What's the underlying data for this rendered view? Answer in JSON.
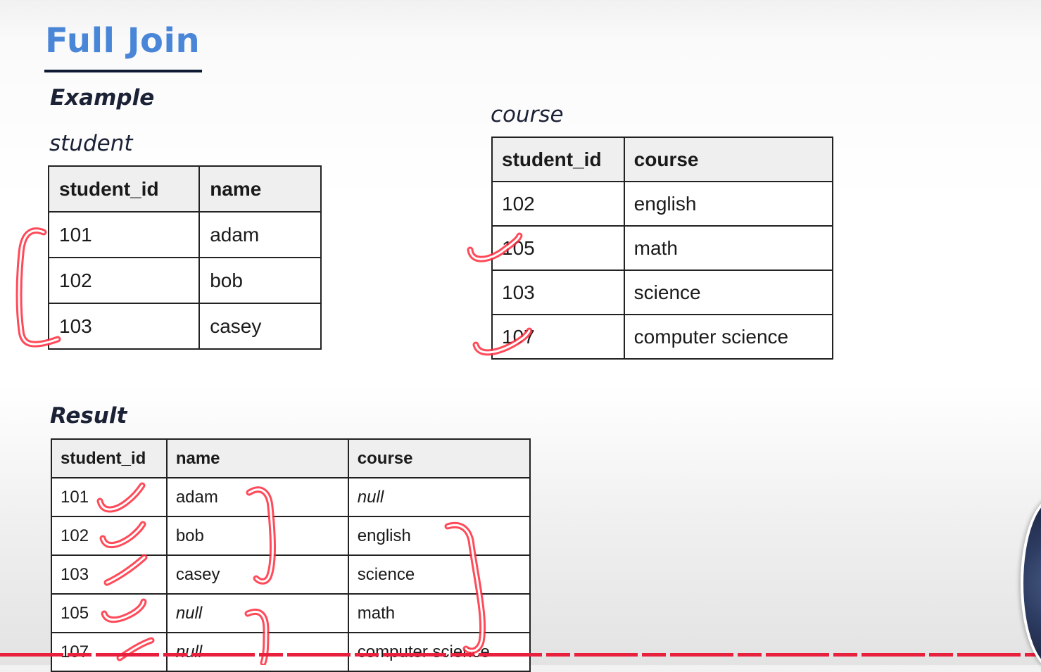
{
  "slide": {
    "title": "Full Join",
    "example_label": "Example",
    "result_label": "Result"
  },
  "student": {
    "caption": "student",
    "headers": [
      "student_id",
      "name"
    ],
    "rows": [
      [
        "101",
        "adam"
      ],
      [
        "102",
        "bob"
      ],
      [
        "103",
        "casey"
      ]
    ]
  },
  "course": {
    "caption": "course",
    "headers": [
      "student_id",
      "course"
    ],
    "rows": [
      [
        "102",
        "english"
      ],
      [
        "105",
        "math"
      ],
      [
        "103",
        "science"
      ],
      [
        "107",
        "computer science"
      ]
    ]
  },
  "result": {
    "headers": [
      "student_id",
      "name",
      "course"
    ],
    "rows": [
      [
        "101",
        "adam",
        "null"
      ],
      [
        "102",
        "bob",
        "english"
      ],
      [
        "103",
        "casey",
        "science"
      ],
      [
        "105",
        "null",
        "math"
      ],
      [
        "107",
        "null",
        "computer science"
      ]
    ]
  },
  "colors": {
    "title": "#4a86d8",
    "annotation": "#ff2a3c",
    "border": "#222222",
    "header_bg": "#f0eff0"
  }
}
